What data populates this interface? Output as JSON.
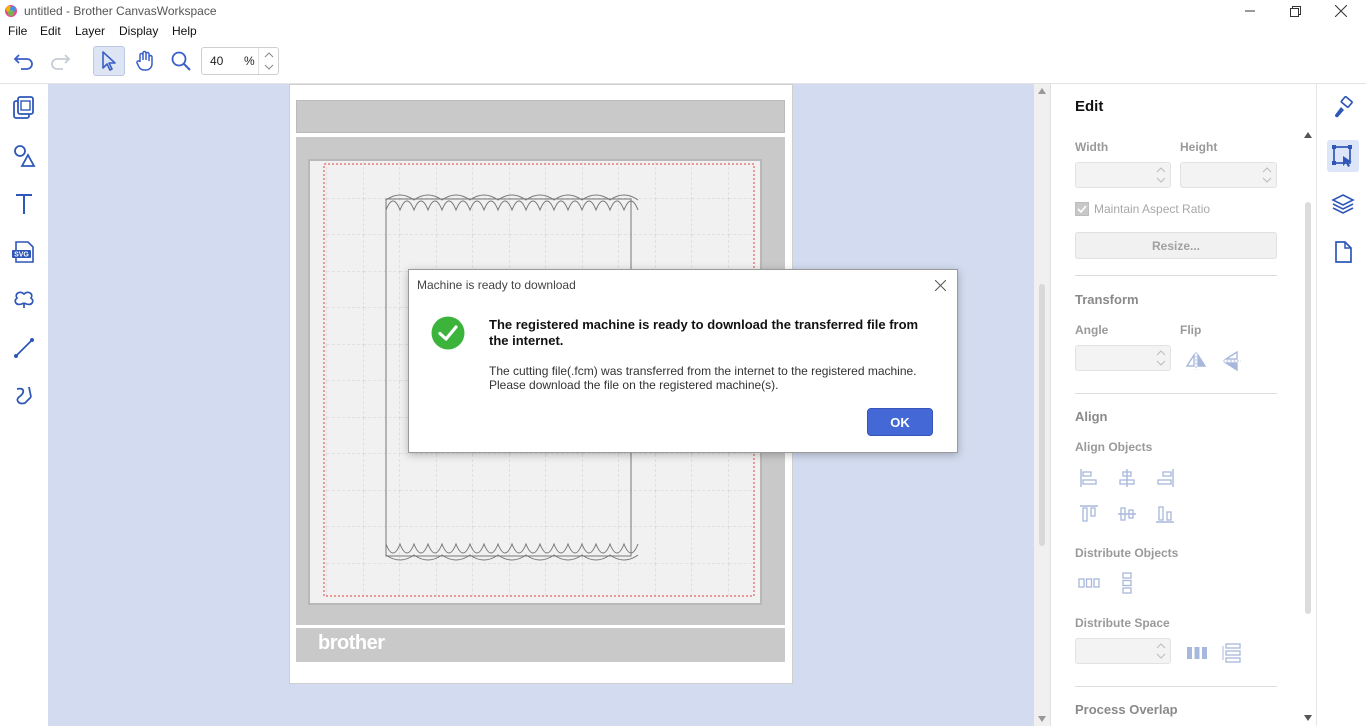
{
  "window": {
    "title": "untitled - Brother CanvasWorkspace",
    "minimize_icon": "minimize-icon",
    "restore_icon": "restore-icon",
    "close_icon": "close-icon"
  },
  "menu": {
    "items": [
      "File",
      "Edit",
      "Layer",
      "Display",
      "Help"
    ]
  },
  "toolbar": {
    "undo_icon": "undo-icon",
    "redo_icon": "redo-icon",
    "select_icon": "pointer-icon",
    "hand_icon": "hand-icon",
    "zoom_icon": "magnifier-icon",
    "zoom_value": "40",
    "zoom_unit": "%"
  },
  "left_tools": [
    "templates-icon",
    "shapes-icon",
    "text-icon",
    "svg-import-icon",
    "clipart-icon",
    "line-icon",
    "freehand-icon"
  ],
  "canvas": {
    "brand": "brother"
  },
  "right_panel": {
    "title": "Edit",
    "width_label": "Width",
    "height_label": "Height",
    "maintain_aspect": "Maintain Aspect Ratio",
    "resize_label": "Resize...",
    "transform_head": "Transform",
    "angle_label": "Angle",
    "flip_label": "Flip",
    "align_head": "Align",
    "align_objects_label": "Align Objects",
    "distribute_objects_label": "Distribute Objects",
    "distribute_space_label": "Distribute Space",
    "process_overlap_head": "Process Overlap"
  },
  "far_right_tools": [
    "paint-icon",
    "edit-select-icon",
    "layers-icon",
    "page-icon"
  ],
  "dialog": {
    "title": "Machine is ready to download",
    "heading": "The registered machine is ready to download the transferred file from the internet.",
    "message_line1": "The cutting file(.fcm) was transferred from the internet to the registered machine.",
    "message_line2": "Please download the file on the registered machine(s).",
    "ok_label": "OK",
    "accent": "#4468d6",
    "success_color": "#3cb43c"
  }
}
